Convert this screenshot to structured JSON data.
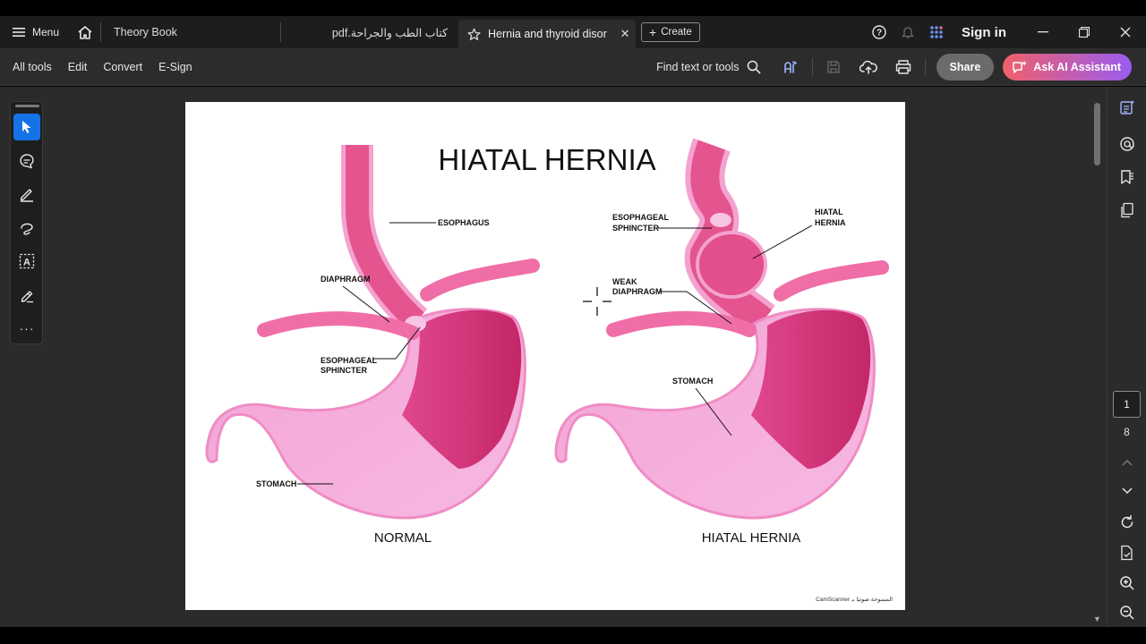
{
  "titlebar": {
    "menu_label": "Menu",
    "tabs": [
      {
        "label": "Theory Book"
      },
      {
        "label": "pdf.كتاب الطب والجراحة"
      },
      {
        "label": "Hernia and thyroid disor..."
      }
    ],
    "create_label": "Create",
    "signin_label": "Sign in"
  },
  "toolbar": {
    "items": [
      "All tools",
      "Edit",
      "Convert",
      "E-Sign"
    ],
    "find_label": "Find text or tools",
    "share_label": "Share",
    "ai_label": "Ask AI Assistant"
  },
  "navigation": {
    "current_page": "1",
    "total_pages": "8"
  },
  "document": {
    "title": "HIATAL HERNIA",
    "left_caption": "NORMAL",
    "right_caption": "HIATAL HERNIA",
    "left_labels": {
      "esophagus": "ESOPHAGUS",
      "diaphragm": "DIAPHRAGM",
      "sphincter_1": "ESOPHAGEAL",
      "sphincter_2": "SPHINCTER",
      "stomach": "STOMACH"
    },
    "right_labels": {
      "sphincter_1": "ESOPHAGEAL",
      "sphincter_2": "SPHINCTER",
      "hernia_1": "HIATAL",
      "hernia_2": "HERNIA",
      "weak_1": "WEAK",
      "weak_2": "DIAPHRAGM",
      "stomach": "STOMACH"
    },
    "watermark": "CamScanner المسوحة ضوئيا بـ"
  },
  "colors": {
    "accent_blue": "#1473e6",
    "stomach_light": "#f7a8d8",
    "stomach_dark": "#d0306f",
    "diaphragm": "#f06ea8"
  }
}
